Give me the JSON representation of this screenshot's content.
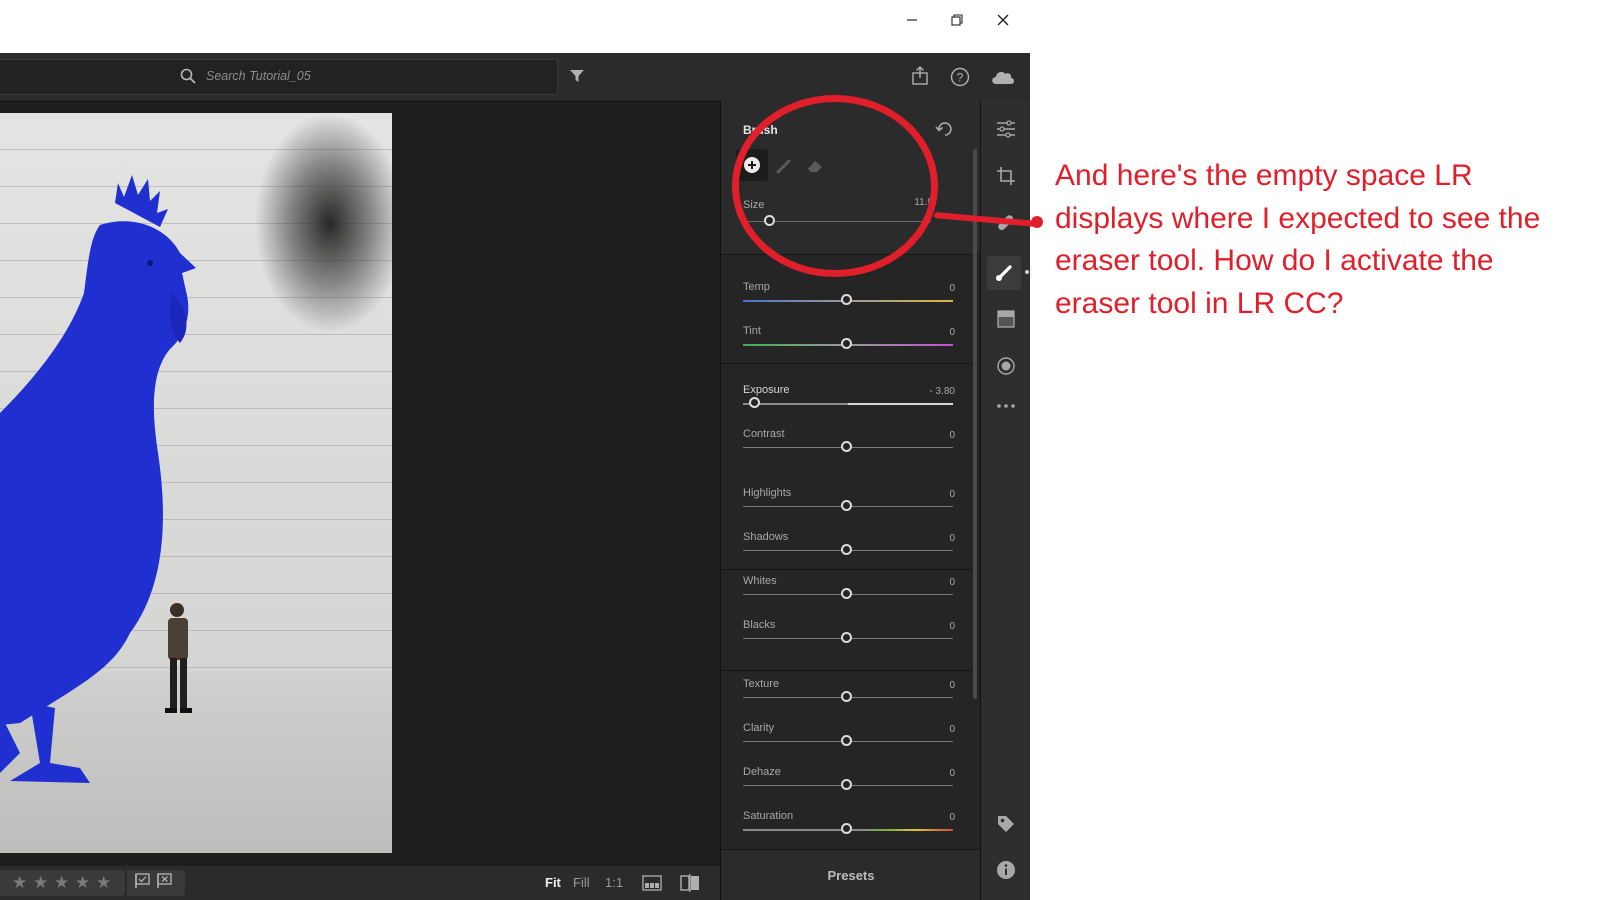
{
  "search": {
    "placeholder": "Search Tutorial_05"
  },
  "brush": {
    "title": "Brush",
    "size_label": "Size",
    "size_value": "11.9",
    "size_level": 0.15
  },
  "sliders": [
    {
      "label": "Temp",
      "value": "0",
      "level": 0.5,
      "track": "temp"
    },
    {
      "label": "Tint",
      "value": "0",
      "level": 0.5,
      "track": "tint"
    },
    {
      "label": "Exposure",
      "value": "- 3.80",
      "level": 0.06,
      "track": "exposure"
    },
    {
      "label": "Contrast",
      "value": "0",
      "level": 0.5,
      "track": "plain"
    },
    {
      "label": "Highlights",
      "value": "0",
      "level": 0.5,
      "track": "plain"
    },
    {
      "label": "Shadows",
      "value": "0",
      "level": 0.5,
      "track": "plain"
    },
    {
      "label": "Whites",
      "value": "0",
      "level": 0.5,
      "track": "plain"
    },
    {
      "label": "Blacks",
      "value": "0",
      "level": 0.5,
      "track": "plain"
    },
    {
      "label": "Texture",
      "value": "0",
      "level": 0.5,
      "track": "plain"
    },
    {
      "label": "Clarity",
      "value": "0",
      "level": 0.5,
      "track": "plain"
    },
    {
      "label": "Dehaze",
      "value": "0",
      "level": 0.5,
      "track": "plain"
    },
    {
      "label": "Saturation",
      "value": "0",
      "level": 0.5,
      "track": "saturation"
    }
  ],
  "presets": {
    "label": "Presets"
  },
  "zoom": {
    "fit": "Fit",
    "fill": "Fill",
    "one_to_one": "1:1"
  },
  "rating": {
    "stars": 5,
    "star_glyph": "★"
  },
  "annotation": {
    "text": "And here's the empty space LR displays where I expected to see the eraser tool. How do I activate the eraser tool in LR CC?",
    "color": "#e01f2a"
  },
  "colors": {
    "app_bg": "#1f1f1f",
    "panel_bg": "#252525",
    "accent": "#e01f2a",
    "sculpture_blue": "#1f2fd0"
  }
}
